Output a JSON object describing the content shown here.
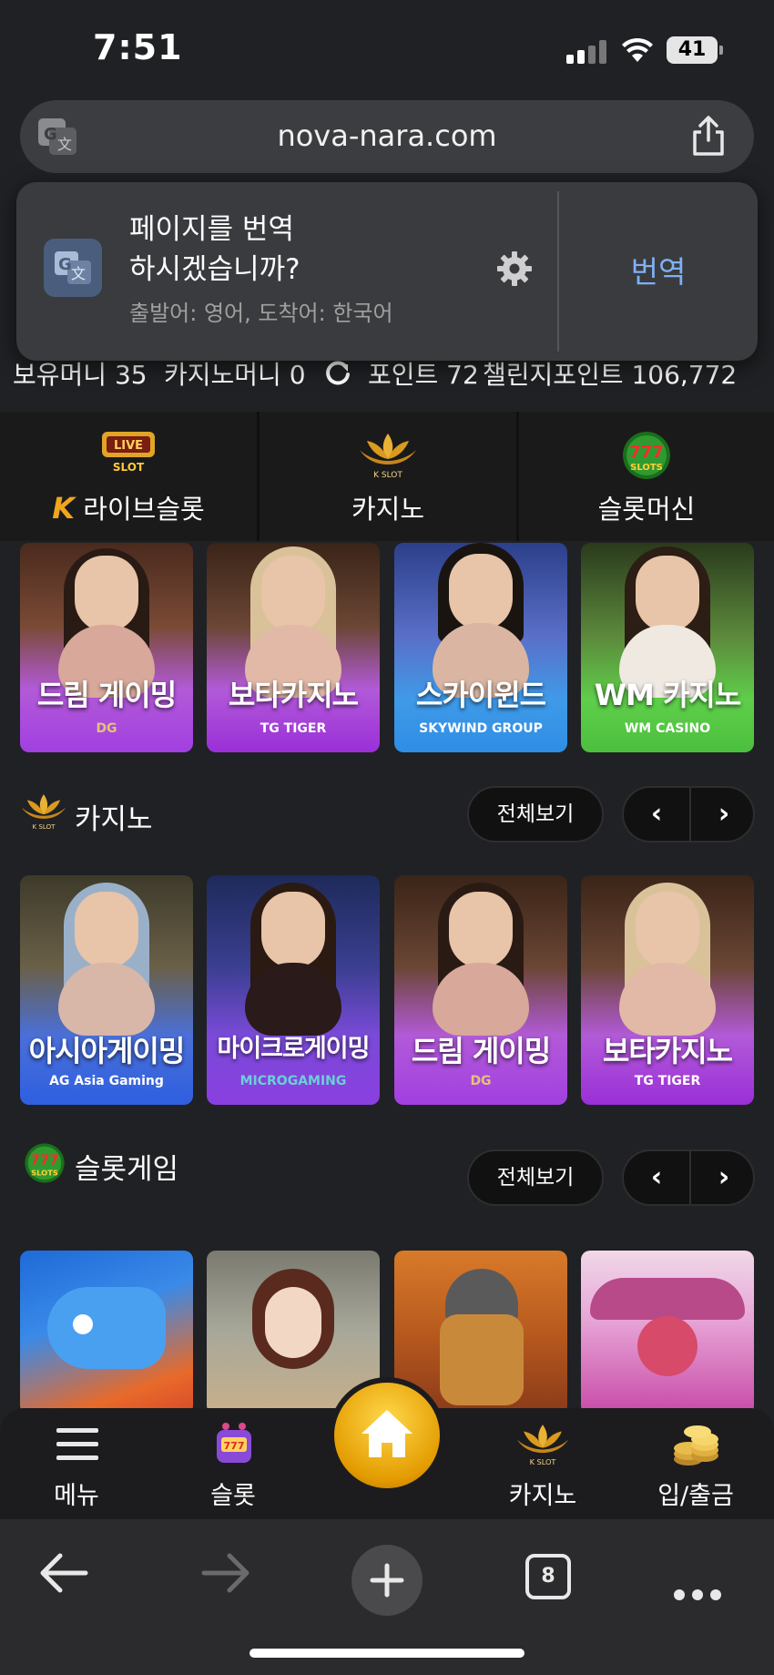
{
  "status_bar": {
    "time": "7:51",
    "battery": "41"
  },
  "browser": {
    "url": "nova-nara.com",
    "tab_count": "8"
  },
  "translate_popup": {
    "title_line1": "페이지를 번역",
    "title_line2": "하시겠습니까?",
    "subtitle": "출발어: 영어, 도착어: 한국어",
    "action": "번역"
  },
  "balance": {
    "holding_money": "보유머니 35",
    "casino_money": "카지노머니 0",
    "points": "포인트 72",
    "challenge_points": "챌린지포인트 106,772"
  },
  "categories": [
    {
      "label": "라이브슬롯",
      "logo_text": "LIVE SLOT",
      "prefix": "K"
    },
    {
      "label": "카지노",
      "logo_text": "K SLOT"
    },
    {
      "label": "슬롯머신",
      "logo_text": "777 SLOTS"
    }
  ],
  "featured_tiles": [
    {
      "name": "드림 게이밍",
      "brand": "DG"
    },
    {
      "name": "보타카지노",
      "brand": "TG TIGER"
    },
    {
      "name": "스카이윈드",
      "brand": "SKYWIND GROUP"
    },
    {
      "name": "WM 카지노",
      "brand": "WM CASINO"
    }
  ],
  "casino_section": {
    "title": "카지노",
    "view_all": "전체보기",
    "logo_text": "K SLOT",
    "tiles": [
      {
        "name": "아시아게이밍",
        "brand": "AG Asia Gaming"
      },
      {
        "name": "마이크로게이밍",
        "brand": "MICROGAMING"
      },
      {
        "name": "드림 게이밍",
        "brand": "DG"
      },
      {
        "name": "보타카지노",
        "brand": "TG TIGER"
      }
    ]
  },
  "slot_section": {
    "title": "슬롯게임",
    "view_all": "전체보기",
    "logo_text": "777 SLOTS"
  },
  "site_nav": [
    {
      "label": "메뉴",
      "icon": "hamburger-icon"
    },
    {
      "label": "슬롯",
      "icon": "slot-machine-icon"
    },
    {
      "label": "홈",
      "icon": "home-icon"
    },
    {
      "label": "카지노",
      "icon": "casino-icon"
    },
    {
      "label": "입/출금",
      "icon": "coins-icon"
    }
  ],
  "arrows": {
    "prev": "‹",
    "next": "›"
  },
  "colors": {
    "accent_blue": "#7fb0f5",
    "home_gold": "#f0b400",
    "tile_purple": "#a547e8",
    "tile_blue": "#2f8de4",
    "tile_green": "#4bbf3e"
  }
}
